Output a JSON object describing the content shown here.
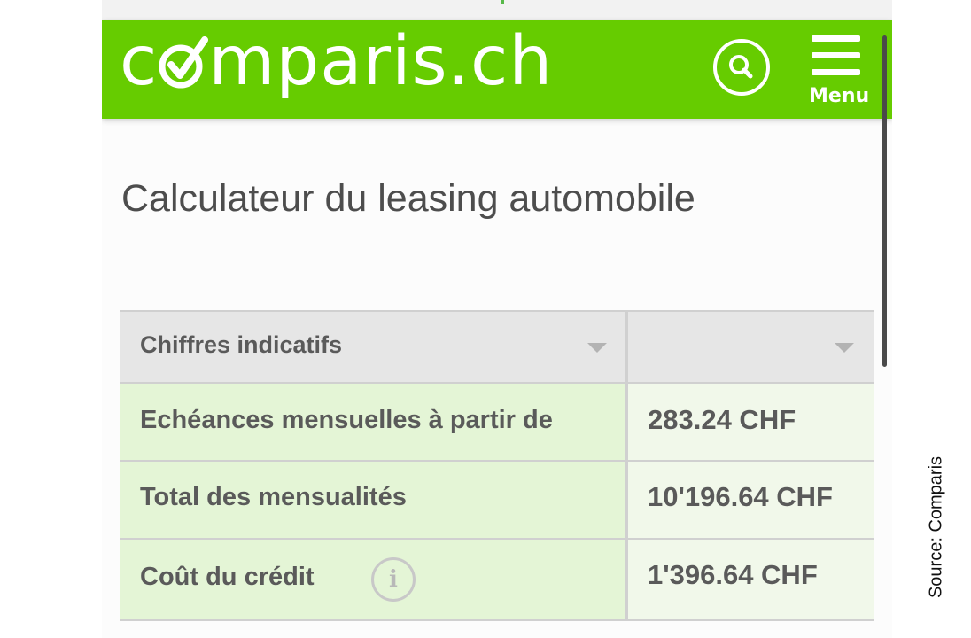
{
  "header": {
    "logo_pre": "c",
    "logo_post": "mparis.ch",
    "search_icon": "search-icon",
    "menu_icon": "hamburger-menu-icon",
    "menu_label": "Menu"
  },
  "page": {
    "title": "Calculateur du leasing automobile"
  },
  "table": {
    "header": {
      "left_label": "Chiffres indicatifs",
      "right_label": ""
    },
    "rows": [
      {
        "label": "Echéances mensuelles à partir de",
        "value": "283.24 CHF"
      },
      {
        "label": "Total des mensualités",
        "value": "10'196.64 CHF"
      },
      {
        "label": "Coût du crédit",
        "value": "1'396.64 CHF",
        "info_icon": "info-icon"
      }
    ]
  },
  "source": "Source: Comparis",
  "colors": {
    "brand_green": "#66cc00",
    "row_label_bg": "#e4f5d6",
    "row_value_bg": "#f1f8ea",
    "header_row_bg": "#e6e6e6",
    "text": "#5a5a5a"
  }
}
